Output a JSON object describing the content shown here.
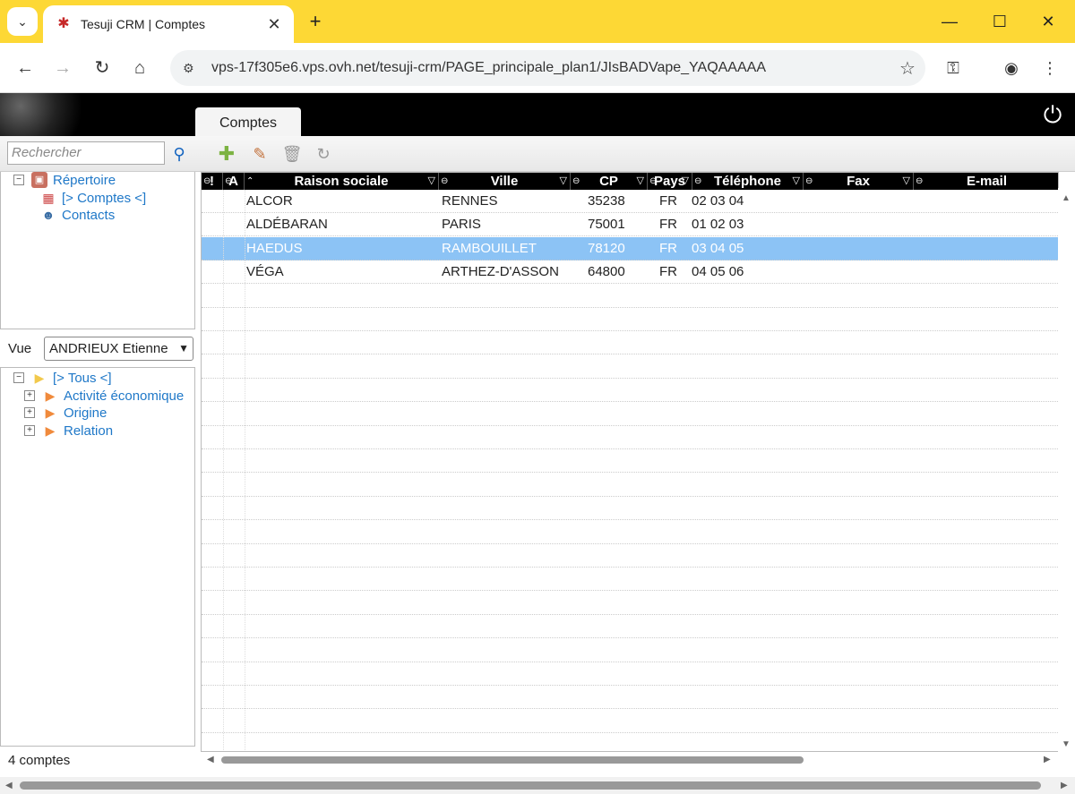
{
  "browser": {
    "tab_title": "Tesuji CRM | Comptes",
    "url": "vps-17f305e6.vps.ovh.net/tesuji-crm/PAGE_principale_plan1/JIsBADVape_YAQAAAAA",
    "accent_color": "#fdd835"
  },
  "app": {
    "tab_label": "Comptes",
    "search_placeholder": "Rechercher",
    "toolbar": {
      "add_icon": "plus-icon",
      "edit_icon": "pencil-icon",
      "delete_icon": "trash-icon",
      "refresh_icon": "refresh-icon"
    }
  },
  "tree": {
    "root": "Répertoire",
    "items": [
      "[> Comptes <]",
      "Contacts"
    ]
  },
  "view": {
    "label": "Vue",
    "selected": "ANDRIEUX Etienne"
  },
  "filter_tree": {
    "root": "[> Tous <]",
    "items": [
      "Activité économique",
      "Origine",
      "Relation"
    ]
  },
  "grid": {
    "columns": [
      "!",
      "A",
      "Raison sociale",
      "Ville",
      "CP",
      "Pays",
      "Téléphone",
      "Fax",
      "E-mail"
    ],
    "rows": [
      {
        "raison": "ALCOR",
        "ville": "RENNES",
        "cp": "35238",
        "pays": "FR",
        "tel": "02 03 04"
      },
      {
        "raison": "ALDÉBARAN",
        "ville": "PARIS",
        "cp": "75001",
        "pays": "FR",
        "tel": "01 02 03"
      },
      {
        "raison": "HAEDUS",
        "ville": "RAMBOUILLET",
        "cp": "78120",
        "pays": "FR",
        "tel": "03 04 05"
      },
      {
        "raison": "VÉGA",
        "ville": "ARTHEZ-D'ASSON",
        "cp": "64800",
        "pays": "FR",
        "tel": "04 05 06"
      }
    ],
    "selected_row": 2,
    "selected_color": "#8cc3f5"
  },
  "status": "4 comptes"
}
